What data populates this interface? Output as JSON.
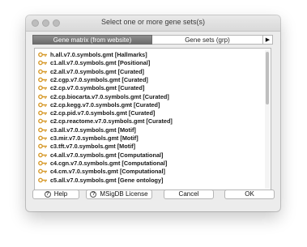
{
  "window": {
    "title": "Select one or more gene sets(s)"
  },
  "tabs": [
    {
      "label": "Gene matrix (from website)",
      "active": true
    },
    {
      "label": "Gene sets (grp)",
      "active": false
    }
  ],
  "tab_scroll_arrow": "▶",
  "gene_sets": [
    {
      "label": "h.all.v7.0.symbols.gmt [Hallmarks]"
    },
    {
      "label": "c1.all.v7.0.symbols.gmt [Positional]"
    },
    {
      "label": "c2.all.v7.0.symbols.gmt [Curated]"
    },
    {
      "label": "c2.cgp.v7.0.symbols.gmt [Curated]"
    },
    {
      "label": "c2.cp.v7.0.symbols.gmt [Curated]"
    },
    {
      "label": "c2.cp.biocarta.v7.0.symbols.gmt [Curated]"
    },
    {
      "label": "c2.cp.kegg.v7.0.symbols.gmt [Curated]"
    },
    {
      "label": "c2.cp.pid.v7.0.symbols.gmt [Curated]"
    },
    {
      "label": "c2.cp.reactome.v7.0.symbols.gmt [Curated]"
    },
    {
      "label": "c3.all.v7.0.symbols.gmt [Motif]"
    },
    {
      "label": "c3.mir.v7.0.symbols.gmt [Motif]"
    },
    {
      "label": "c3.tft.v7.0.symbols.gmt [Motif]"
    },
    {
      "label": "c4.all.v7.0.symbols.gmt [Computational]"
    },
    {
      "label": "c4.cgn.v7.0.symbols.gmt [Computational]"
    },
    {
      "label": "c4.cm.v7.0.symbols.gmt [Computational]"
    },
    {
      "label": "c5.all.v7.0.symbols.gmt [Gene ontology]"
    }
  ],
  "buttons": {
    "help": "Help",
    "msigdb_license": "MSigDB License",
    "cancel": "Cancel",
    "ok": "OK"
  },
  "icons": {
    "list_item": "key-icon",
    "help": "help-icon"
  },
  "colors": {
    "active_tab": "#7d7d7d",
    "key_icon": "#d79a2b",
    "window_bg": "#ececec"
  }
}
